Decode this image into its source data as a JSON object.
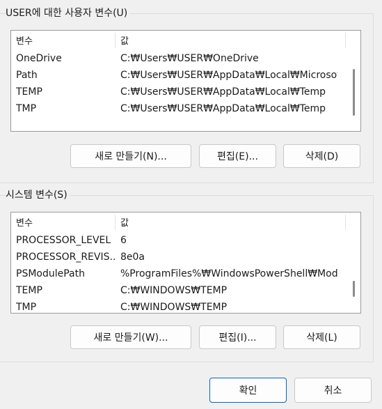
{
  "user_vars": {
    "title": "USER에 대한 사용자 변수(U)",
    "col_name": "변수",
    "col_value": "값",
    "rows": [
      {
        "name": "OneDrive",
        "value": "C:₩Users₩USER₩OneDrive"
      },
      {
        "name": "Path",
        "value": "C:₩Users₩USER₩AppData₩Local₩Microsoft..."
      },
      {
        "name": "TEMP",
        "value": "C:₩Users₩USER₩AppData₩Local₩Temp"
      },
      {
        "name": "TMP",
        "value": "C:₩Users₩USER₩AppData₩Local₩Temp"
      }
    ],
    "btn_new": "새로 만들기(N)...",
    "btn_edit": "편집(E)...",
    "btn_delete": "삭제(D)"
  },
  "system_vars": {
    "title": "시스템 변수(S)",
    "col_name": "변수",
    "col_value": "값",
    "rows": [
      {
        "name": "PROCESSOR_LEVEL",
        "value": "6"
      },
      {
        "name": "PROCESSOR_REVIS...",
        "value": "8e0a"
      },
      {
        "name": "PSModulePath",
        "value": "%ProgramFiles%₩WindowsPowerShell₩Mod..."
      },
      {
        "name": "TEMP",
        "value": "C:₩WINDOWS₩TEMP"
      },
      {
        "name": "TMP",
        "value": "C:₩WINDOWS₩TEMP"
      }
    ],
    "btn_new": "새로 만들기(W)...",
    "btn_edit": "편집(I)...",
    "btn_delete": "삭제(L)"
  },
  "dialog": {
    "ok": "확인",
    "cancel": "취소"
  },
  "colors": {
    "accent": "#0067c0",
    "background": "#f0f0f0"
  }
}
